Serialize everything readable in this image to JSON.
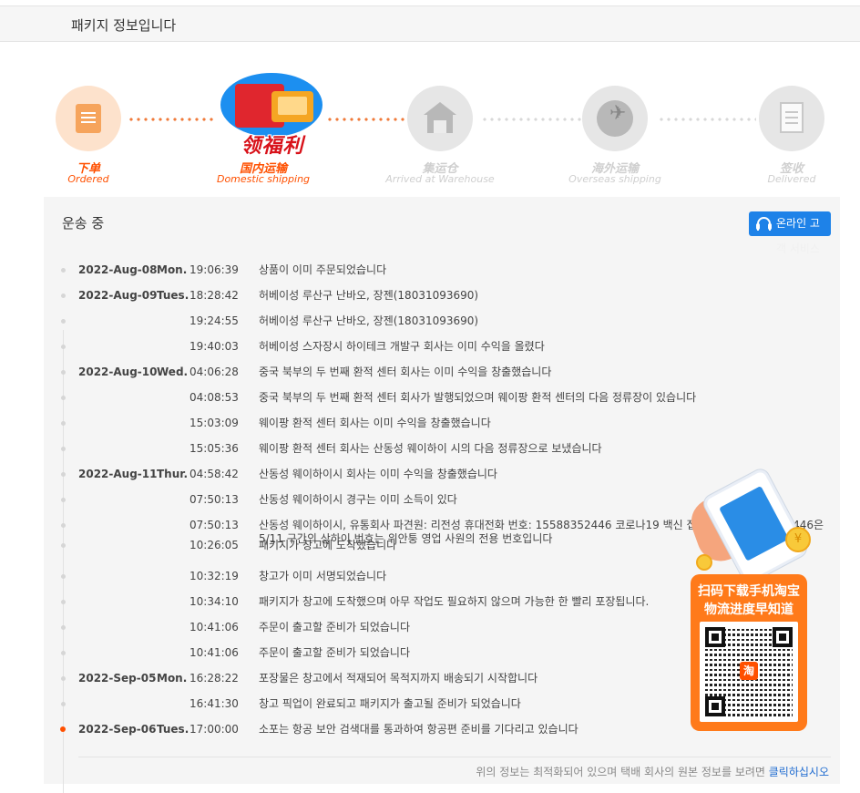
{
  "header": {
    "title": "패키지 정보입니다"
  },
  "steps": [
    {
      "cn": "下单",
      "en": "Ordered",
      "icon": "order-document-icon"
    },
    {
      "cn": "国内运输",
      "en": "Domestic shipping",
      "icon": "red-packet-promo-icon",
      "promo_text": "领福利"
    },
    {
      "cn": "集运仓",
      "en": "Arrived at Warehouse",
      "icon": "warehouse-icon"
    },
    {
      "cn": "海外运输",
      "en": "Overseas shipping",
      "icon": "globe-plane-icon"
    },
    {
      "cn": "签收",
      "en": "Delivered",
      "icon": "receipt-icon"
    }
  ],
  "panel": {
    "title": "운송 중",
    "cs_button": "온라인 고객 서비스",
    "cs_button_visible": "온라인 고",
    "cs_button_overflow": "객 서비스"
  },
  "tracking": [
    {
      "date": "2022-Aug-08",
      "day": "Mon.",
      "time": "19:06:39",
      "desc": "상품이 이미 주문되었습니다"
    },
    {
      "date": "2022-Aug-09",
      "day": "Tues.",
      "time": "18:28:42",
      "desc": "허베이성 루산구 난바오, 장젠(18031093690)"
    },
    {
      "date": "",
      "day": "",
      "time": "19:24:55",
      "desc": "허베이성 루산구 난바오, 장젠(18031093690)"
    },
    {
      "date": "",
      "day": "",
      "time": "19:40:03",
      "desc": "허베이성 스자장시 하이테크 개발구 회사는 이미 수익을 올렸다"
    },
    {
      "date": "2022-Aug-10",
      "day": "Wed.",
      "time": "04:06:28",
      "desc": "중국 북부의 두 번째 환적 센터 회사는 이미 수익을 창출했습니다"
    },
    {
      "date": "",
      "day": "",
      "time": "04:08:53",
      "desc": "중국 북부의 두 번째 환적 센터 회사가 발행되었으며 웨이팡 환적 센터의 다음 정류장이 있습니다"
    },
    {
      "date": "",
      "day": "",
      "time": "15:03:09",
      "desc": "웨이팡 환적 센터 회사는 이미 수익을 창출했습니다"
    },
    {
      "date": "",
      "day": "",
      "time": "15:05:36",
      "desc": "웨이팡 환적 센터 회사는 산동성 웨이하이 시의 다음 정류장으로 보냈습니다"
    },
    {
      "date": "2022-Aug-11",
      "day": "Thur.",
      "time": "04:58:42",
      "desc": "산동성 웨이하이시 회사는 이미 수익을 창출했습니다"
    },
    {
      "date": "",
      "day": "",
      "time": "07:50:13",
      "desc": "산동성 웨이하이시 경구는 이미 소득이 있다"
    },
    {
      "date": "",
      "day": "",
      "time": "07:50:13",
      "desc": "산동성 웨이하이시, 유통회사 파견원: 리전성 휴대전화 번호: 15588352446 코로나19 백신 접종 완료. 15588352446은 5/11 구간의 상하이 번호는 위안퉁 영업 사원의 전용 번호입니다"
    },
    {
      "date": "",
      "day": "",
      "time": "10:26:05",
      "desc": "패키지가 창고에 도착했습니다"
    },
    {
      "date": "",
      "day": "",
      "time": "10:32:19",
      "desc": "창고가 이미 서명되었습니다"
    },
    {
      "date": "",
      "day": "",
      "time": "10:34:10",
      "desc": "패키지가 창고에 도착했으며 아무 작업도 필요하지 않으며 가능한 한 빨리 포장됩니다."
    },
    {
      "date": "",
      "day": "",
      "time": "10:41:06",
      "desc": "주문이 출고할 준비가 되었습니다"
    },
    {
      "date": "",
      "day": "",
      "time": "10:41:06",
      "desc": "주문이 출고할 준비가 되었습니다"
    },
    {
      "date": "2022-Sep-05",
      "day": "Mon.",
      "time": "16:28:22",
      "desc": "포장물은 창고에서 적재되어 목적지까지 배송되기 시작합니다"
    },
    {
      "date": "",
      "day": "",
      "time": "16:41:30",
      "desc": "창고 픽업이 완료되고 패키지가 출고될 준비가 되었습니다"
    },
    {
      "date": "2022-Sep-06",
      "day": "Tues.",
      "time": "17:00:00",
      "desc": "소포는 항공 보안 검색대를 통과하여 항공편 준비를 기다리고 있습니다"
    }
  ],
  "footer": {
    "note": "위의 정보는 최적화되어 있으며 택배 회사의 원본 정보를 보려면 ",
    "link": "클릭하십시오"
  },
  "qr_promo": {
    "line1": "扫码下载手机淘宝",
    "line2": "物流进度早知道",
    "coin": "¥",
    "logo": "淘"
  },
  "colors": {
    "accent": "#ff5000",
    "button_blue": "#1e82e8",
    "qr_orange": "#ff7a1a"
  }
}
